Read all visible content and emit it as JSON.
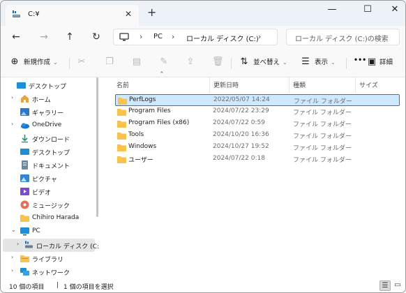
{
  "titlebar": {
    "tab_title": "C:¥",
    "tab_close": "✕",
    "new_tab": "+",
    "minimize": "—",
    "maximize": "☐",
    "close": "✕"
  },
  "address": {
    "breadcrumbs": [
      "PC",
      "ローカル ディスク (C:)"
    ],
    "separator": "›",
    "search_placeholder": "ローカル ディスク (C:)の検索"
  },
  "commands": {
    "new_label": "新規作成",
    "sort_label": "並べ替え",
    "view_label": "表示",
    "more_label": "•••",
    "details_label": "詳細"
  },
  "sidebar": {
    "items": [
      {
        "label": "デスクトップ",
        "icon": "desktop-icon"
      },
      {
        "label": "ホーム",
        "icon": "home-icon"
      },
      {
        "label": "ギャラリー",
        "icon": "gallery-icon"
      },
      {
        "label": "OneDrive",
        "icon": "onedrive-icon"
      },
      {
        "label": "ダウンロード",
        "icon": "download-icon"
      },
      {
        "label": "デスクトップ",
        "icon": "desktop-icon"
      },
      {
        "label": "ドキュメント",
        "icon": "document-icon"
      },
      {
        "label": "ピクチャ",
        "icon": "pictures-icon"
      },
      {
        "label": "ビデオ",
        "icon": "video-icon"
      },
      {
        "label": "ミュージック",
        "icon": "music-icon"
      },
      {
        "label": "Chihiro Harada",
        "icon": "folder-icon"
      },
      {
        "label": "PC",
        "icon": "pc-icon"
      },
      {
        "label": "ローカル ディスク (C:)",
        "icon": "drive-icon",
        "selected": true
      },
      {
        "label": "ライブラリ",
        "icon": "library-icon"
      },
      {
        "label": "ネットワーク",
        "icon": "network-icon"
      }
    ]
  },
  "columns": [
    "名前",
    "更新日時",
    "種類",
    "サイズ"
  ],
  "files": [
    {
      "name": "PerfLogs",
      "date": "2022/05/07 14:24",
      "type": "ファイル フォルダー",
      "selected": true
    },
    {
      "name": "Program Files",
      "date": "2024/07/22 23:29",
      "type": "ファイル フォルダー"
    },
    {
      "name": "Program Files (x86)",
      "date": "2024/07/22 0:59",
      "type": "ファイル フォルダー"
    },
    {
      "name": "Tools",
      "date": "2024/10/20 16:36",
      "type": "ファイル フォルダー"
    },
    {
      "name": "Windows",
      "date": "2024/10/27 19:52",
      "type": "ファイル フォルダー"
    },
    {
      "name": "ユーザー",
      "date": "2024/07/22 0:18",
      "type": "ファイル フォルダー"
    }
  ],
  "status": {
    "item_count": "10 個の項目",
    "selected_count": "1 個の項目を選択"
  },
  "colors": {
    "accent": "#0067c0",
    "folder": "#f8c24c",
    "selection": "#cde8ff"
  }
}
